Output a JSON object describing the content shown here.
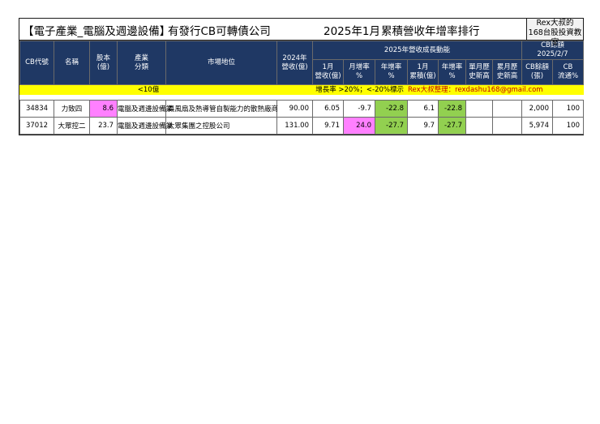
{
  "title": {
    "part1": "【電子產業_電腦及週邊設備】",
    "part2": "有發行CB可轉債公司",
    "part3": "2025年1月",
    "part4": "累積營收年增率排行",
    "brand_line1": "Rex大叔的",
    "brand_line2": "168台股投資教室"
  },
  "headers": {
    "cb_code": "CB代號",
    "name": "名稱",
    "capital": "股本\n(億)",
    "industry": "產業\n分類",
    "market_position": "市場地位",
    "rev_2024": "2024年\n營收(億)",
    "group_2025": "2025年營收成長動能",
    "cb_balance_group": "CB餘額\n2025/2/7",
    "jan_rev": "1月\n營收(億)",
    "mom": "月增率\n%",
    "yoy": "年增率\n%",
    "jan_cum": "1月\n累積(億)",
    "cum_yoy": "年增率\n%",
    "single_month_high": "單月歷\n史新高",
    "cum_month_high": "累月歷\n史新高",
    "cb_balance": "CB餘額\n(張)",
    "cb_circulation": "CB\n流通%"
  },
  "notes": {
    "capital_note": "<10億",
    "growth_note": "增長率 >20%；<-20%標示",
    "author": "Rex大叔整理：rexdashu168@gmail.com"
  },
  "colors": {
    "header_bg": "#1f3864",
    "note_bg": "#ffff00",
    "highlight_pink": "#ff80ff",
    "highlight_green": "#92d050"
  },
  "rows": [
    {
      "cb_code": "34834",
      "name": "力致四",
      "capital": "8.6",
      "industry": "電腦及週邊設備業",
      "market_position": "具風扇及熱導管自製能力的散熱廠商",
      "rev_2024": "90.00",
      "jan_rev": "6.05",
      "mom": "-9.7",
      "yoy": "-22.8",
      "jan_cum": "6.1",
      "cum_yoy": "-22.8",
      "single_high": "",
      "cum_high": "",
      "cb_balance": "2,000",
      "cb_circ": "100"
    },
    {
      "cb_code": "37012",
      "name": "大眾控二",
      "capital": "23.7",
      "industry": "電腦及週邊設備業",
      "market_position": "大眾集團之控股公司",
      "rev_2024": "131.00",
      "jan_rev": "9.71",
      "mom": "24.0",
      "yoy": "-27.7",
      "jan_cum": "9.7",
      "cum_yoy": "-27.7",
      "single_high": "",
      "cum_high": "",
      "cb_balance": "5,974",
      "cb_circ": "100"
    }
  ]
}
